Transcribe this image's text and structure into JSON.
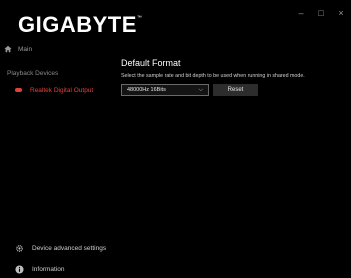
{
  "window": {
    "controls": {
      "minimize": "–",
      "maximize": "□",
      "close": "×"
    }
  },
  "brand": {
    "logo_text": "GIGABYTE",
    "trademark": "™"
  },
  "sidebar": {
    "main_label": "Main",
    "section_label": "Playback Devices",
    "devices": [
      {
        "label": "Realtek Digital Output",
        "selected": true
      }
    ],
    "bottom": {
      "advanced_settings_label": "Device advanced settings",
      "information_label": "Information"
    }
  },
  "main": {
    "title": "Default Format",
    "description": "Select the sample rate and bit depth to be used when running in shared mode.",
    "format_select": {
      "value": "48000Hz 16Bits"
    },
    "reset_label": "Reset"
  },
  "colors": {
    "accent": "#e0413b",
    "background": "#000000",
    "text": "#ffffff"
  }
}
